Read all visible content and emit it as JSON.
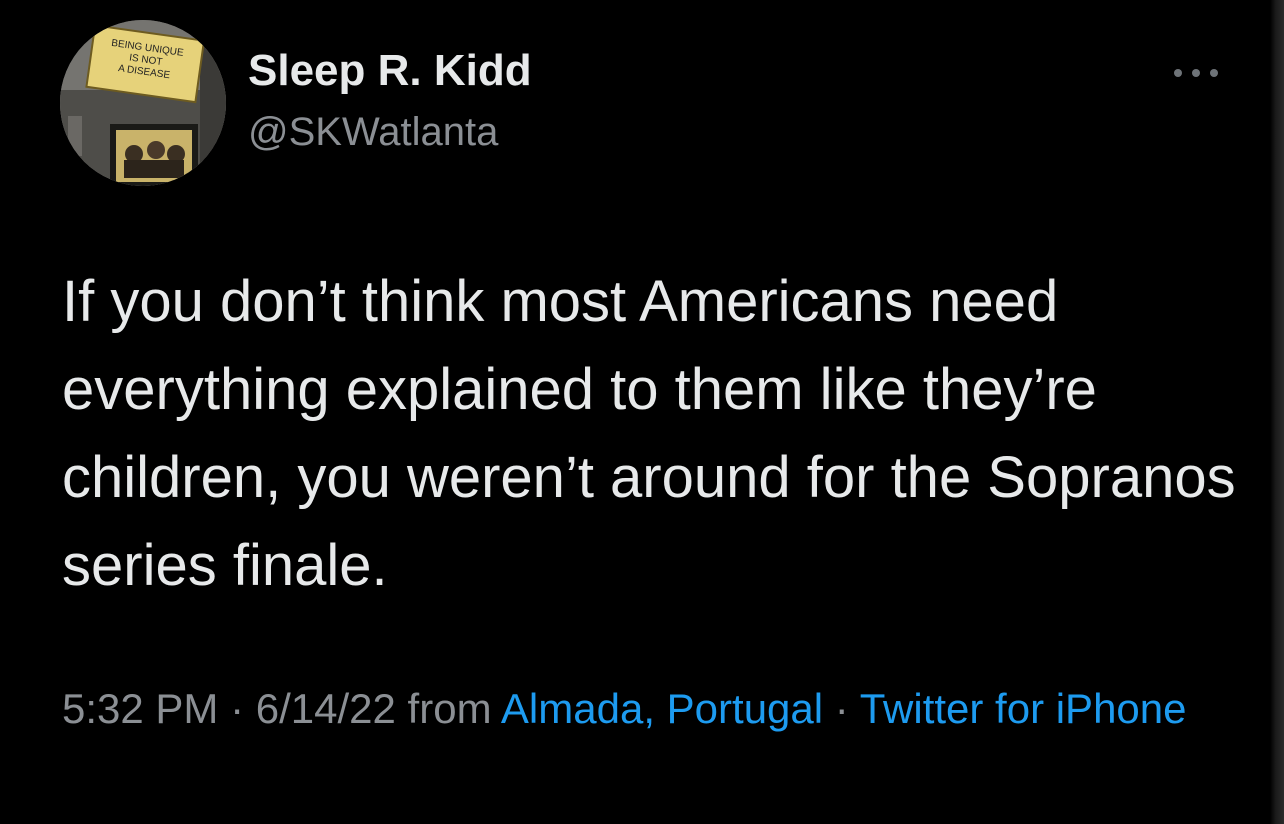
{
  "colors": {
    "background": "#000000",
    "text_primary": "#e7e9ea",
    "text_secondary": "#8b8f94",
    "link": "#1d9bf0"
  },
  "user": {
    "display_name": "Sleep R. Kidd",
    "handle": "@SKWatlanta",
    "avatar_sign_lines": [
      "BEING UNIQUE",
      "IS NOT",
      "A DISEASE"
    ]
  },
  "menu": {
    "more_icon": "more-horizontal-icon"
  },
  "tweet": {
    "text": "If you don’t think most Americans need everything explained to them like they’re children, you weren’t around for the Sopranos series finale."
  },
  "meta": {
    "time": "5:32 PM",
    "separator": " · ",
    "date": "6/14/22",
    "from_label": " from ",
    "location": "Almada, Portugal",
    "source": "Twitter for iPhone"
  }
}
